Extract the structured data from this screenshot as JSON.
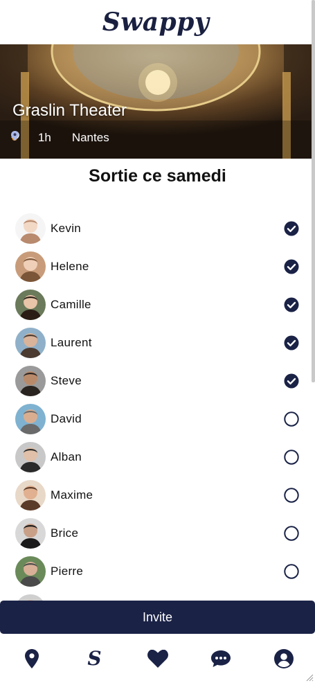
{
  "app": {
    "logo": "Swappy"
  },
  "event": {
    "title": "Graslin Theater",
    "price_symbol": "€",
    "duration": "1h",
    "location": "Nantes"
  },
  "section_title": "Sortie ce samedi",
  "friends": [
    {
      "name": "Kevin",
      "selected": true
    },
    {
      "name": "Helene",
      "selected": true
    },
    {
      "name": "Camille",
      "selected": true
    },
    {
      "name": "Laurent",
      "selected": true
    },
    {
      "name": "Steve",
      "selected": true
    },
    {
      "name": "David",
      "selected": false
    },
    {
      "name": "Alban",
      "selected": false
    },
    {
      "name": "Maxime",
      "selected": false
    },
    {
      "name": "Brice",
      "selected": false
    },
    {
      "name": "Pierre",
      "selected": false
    },
    {
      "name": "",
      "selected": false
    }
  ],
  "invite_label": "Invite",
  "nav": [
    {
      "icon": "map-pin-icon"
    },
    {
      "icon": "swappy-s-icon",
      "glyph": "S"
    },
    {
      "icon": "heart-icon"
    },
    {
      "icon": "chat-icon"
    },
    {
      "icon": "profile-icon"
    }
  ],
  "colors": {
    "primary": "#1a2246",
    "accent": "#e08a1e"
  }
}
